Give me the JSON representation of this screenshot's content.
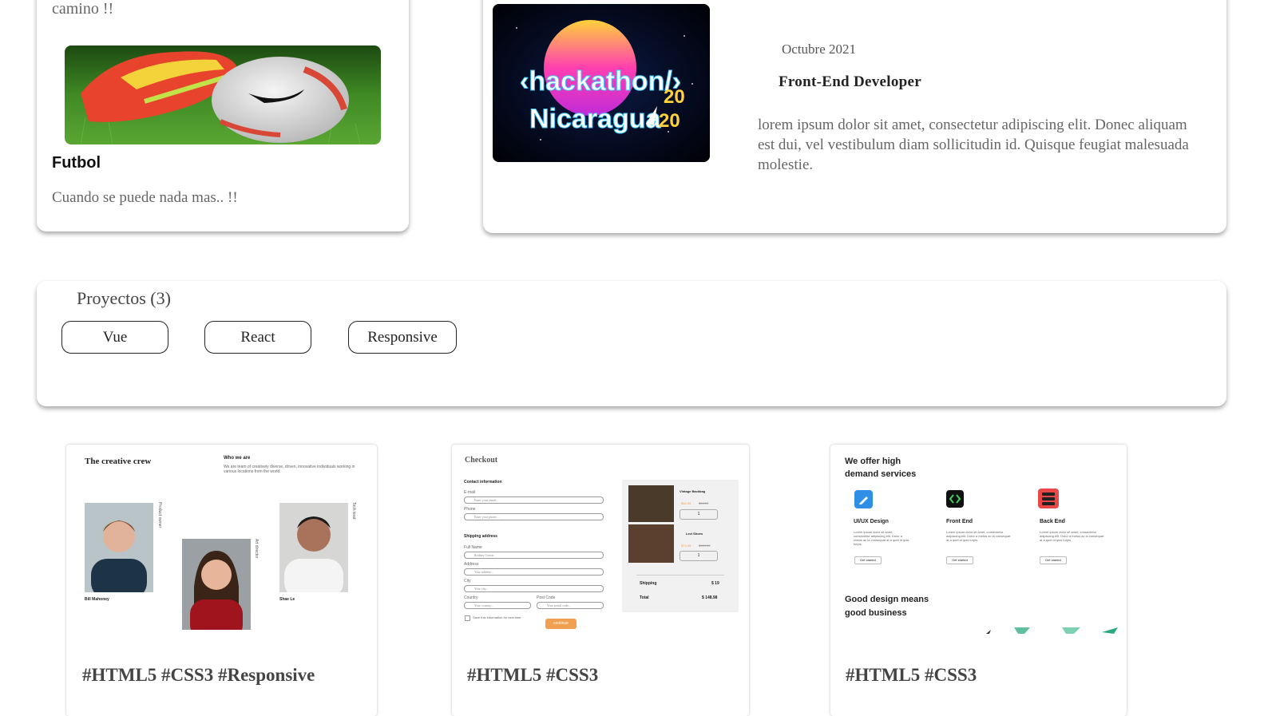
{
  "hobby": {
    "previous_text": "camino !!",
    "title": "Futbol",
    "description": "Cuando se puede nada mas.. !!"
  },
  "experience": {
    "image_text_line1": "‹hackathon/›",
    "image_text_line2": "Nicaragua",
    "image_year_top": "20",
    "image_year_bottom": "20",
    "date": "Octubre 2021",
    "role": "Front-End Developer",
    "description": "lorem ipsum dolor sit amet, consectetur adipiscing elit. Donec aliquam est dui, vel vestibulum diam sollicitudin id. Quisque feugiat malesuada molestie."
  },
  "projects": {
    "title": "Proyectos (3)",
    "filters": [
      "Vue",
      "React",
      "Responsive"
    ]
  },
  "thumbnails": [
    {
      "tags": "#HTML5 #CSS3 #Responsive",
      "heading": "The creative crew",
      "sub_heading": "Who we are",
      "sub_text": "We are team of creatively diverse, driven, innovative individuals working in various locations from the world.",
      "people": [
        {
          "name": "Bill Mahoney",
          "role": "Product owner"
        },
        {
          "name": "",
          "role": "Art director"
        },
        {
          "name": "Shae Le",
          "role": "Tech lead"
        }
      ]
    },
    {
      "tags": "#HTML5 #CSS3",
      "heading": "Checkout",
      "contact_label": "Contact information",
      "email_label": "E-mail",
      "email_placeholder": "Enter your email...",
      "phone_label": "Phone",
      "phone_placeholder": "Enter your phone...",
      "shipping_label": "Shipping address",
      "fullname_label": "Full Name",
      "fullname_placeholder": "Rodney Cotton",
      "address_label": "Address",
      "address_placeholder": "Your address...",
      "city_label": "City",
      "city_placeholder": "Your city...",
      "country_label": "Country",
      "country_placeholder": "Your country...",
      "postcode_label": "Post Code",
      "postcode_placeholder": "Your postal code...",
      "save_info": "Save this information for next time",
      "continue_label": "continue",
      "items": [
        {
          "name": "Vintage Backbag",
          "price": "$54.99",
          "old_price": "$94.99",
          "qty": "1"
        },
        {
          "name": "Levi Shoes",
          "price": "$74.99",
          "old_price": "$124.99",
          "qty": "1"
        }
      ],
      "shipping_text": "Shipping",
      "shipping_value": "$ 19",
      "total_text": "Total",
      "total_value": "$ 148.98"
    },
    {
      "tags": "#HTML5 #CSS3",
      "heading_line1": "We offer high",
      "heading_line2": "demand services",
      "services": [
        {
          "name": "UI/UX Design",
          "color": "#2f8fe6",
          "cta": "Get started"
        },
        {
          "name": "Front End",
          "color": "#111111",
          "cta": "Get started"
        },
        {
          "name": "Back End",
          "color": "#e84848",
          "cta": "Get started"
        }
      ],
      "service_text": "Lorem ipsum dolor sit amet, consectetur adipiscing elit. Dolor a metus ac la consequat at a quet id quis turpis.",
      "footer_line1": "Good design means",
      "footer_line2": "good business"
    }
  ],
  "colors": {
    "accent_orange": "#f0a050",
    "text_muted": "#666666"
  }
}
